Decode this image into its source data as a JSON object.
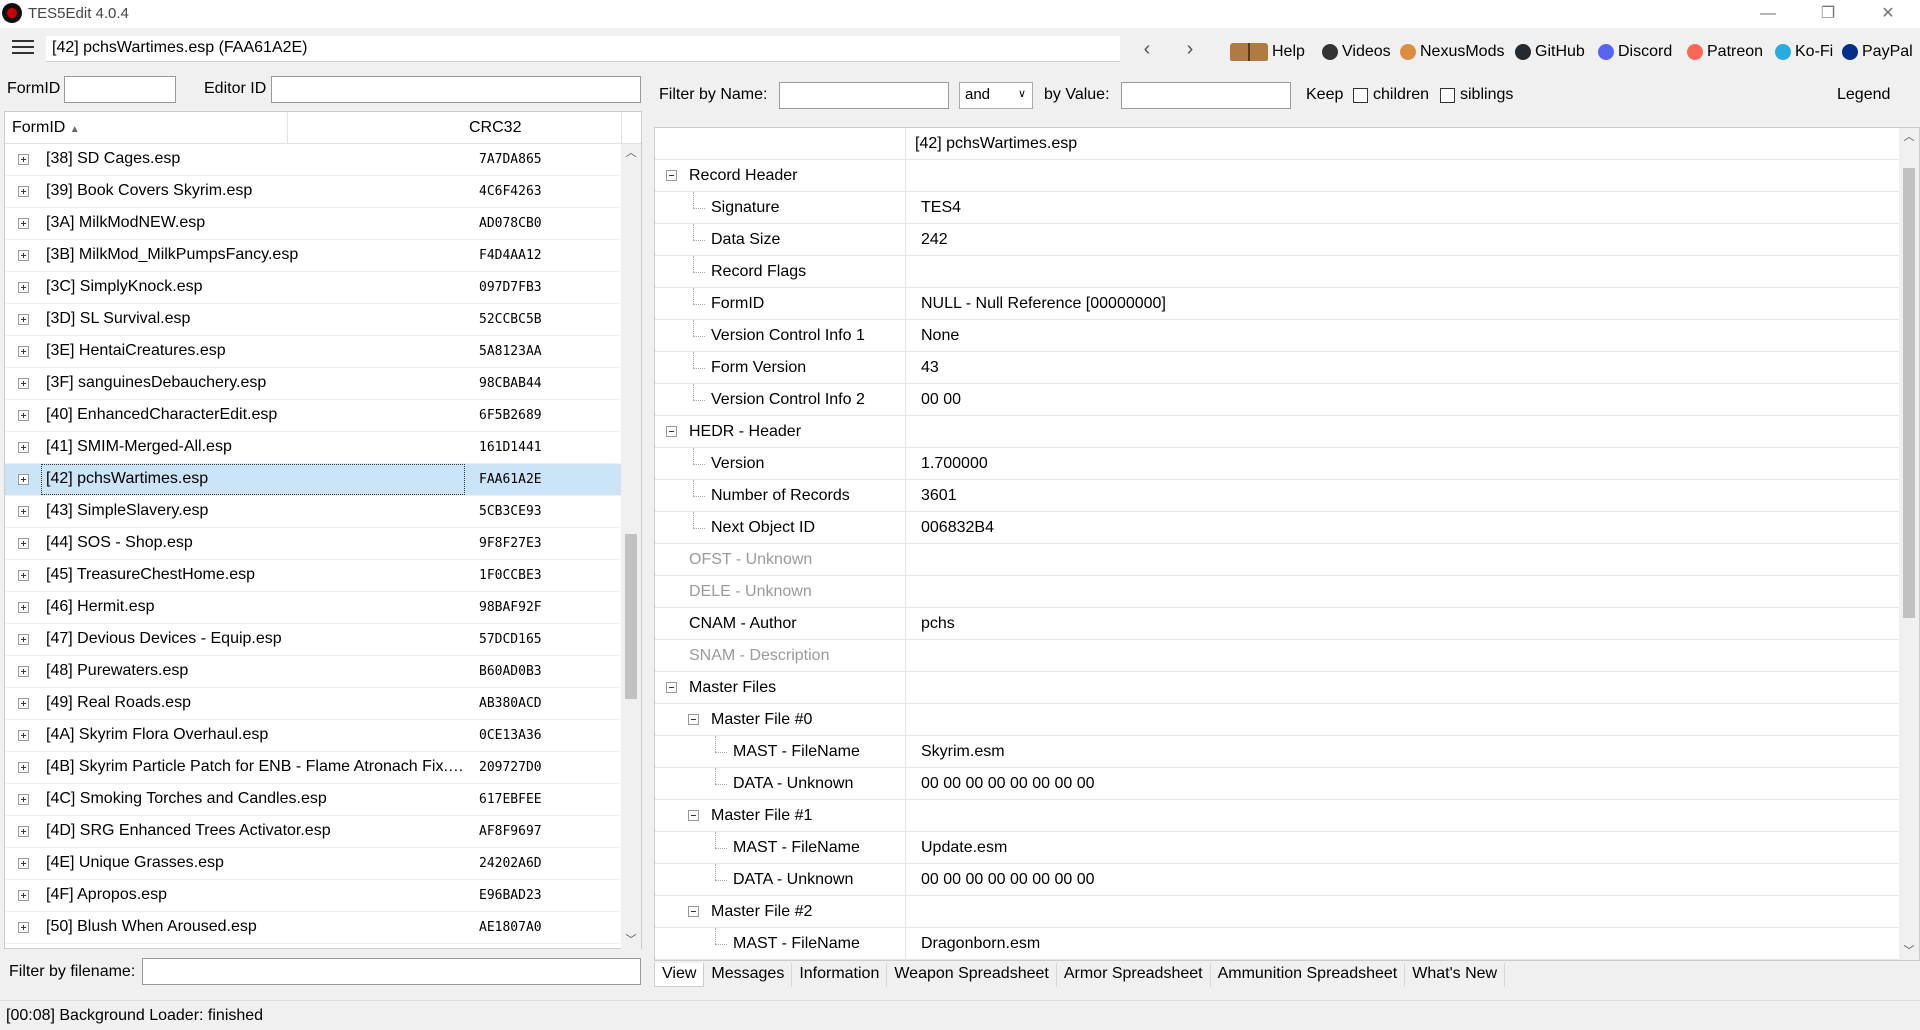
{
  "window": {
    "title": "TES5Edit 4.0.4",
    "minimize": "—",
    "restore": "❐",
    "close": "✕"
  },
  "toolbar": {
    "path": "[42] pchsWartimes.esp (FAA61A2E)",
    "back": "‹",
    "forward": "›",
    "links": [
      {
        "label": "Help",
        "icon": "book-icon",
        "color": "#8a5a2b"
      },
      {
        "label": "Videos",
        "icon": "videos-icon",
        "color": "#333333"
      },
      {
        "label": "NexusMods",
        "icon": "nexusmods-icon",
        "color": "#d98f40"
      },
      {
        "label": "GitHub",
        "icon": "github-icon",
        "color": "#24292e"
      },
      {
        "label": "Discord",
        "icon": "discord-icon",
        "color": "#5865f2"
      },
      {
        "label": "Patreon",
        "icon": "patreon-icon",
        "color": "#f96854"
      },
      {
        "label": "Ko-Fi",
        "icon": "kofi-icon",
        "color": "#29abe0"
      },
      {
        "label": "PayPal",
        "icon": "paypal-icon",
        "color": "#003087"
      }
    ]
  },
  "left": {
    "formid_label": "FormID",
    "editorid_label": "Editor ID",
    "formid_value": "",
    "editorid_value": "",
    "col_formid": "FormID",
    "col_crc": "CRC32",
    "rows": [
      {
        "name": "[38] SD Cages.esp",
        "crc": "7A7DA865"
      },
      {
        "name": "[39] Book Covers Skyrim.esp",
        "crc": "4C6F4263"
      },
      {
        "name": "[3A] MilkModNEW.esp",
        "crc": "AD078CB0"
      },
      {
        "name": "[3B] MilkMod_MilkPumpsFancy.esp",
        "crc": "F4D4AA12"
      },
      {
        "name": "[3C] SimplyKnock.esp",
        "crc": "097D7FB3"
      },
      {
        "name": "[3D] SL Survival.esp",
        "crc": "52CCBC5B"
      },
      {
        "name": "[3E] HentaiCreatures.esp",
        "crc": "5A8123AA"
      },
      {
        "name": "[3F] sanguinesDebauchery.esp",
        "crc": "98CBAB44"
      },
      {
        "name": "[40] EnhancedCharacterEdit.esp",
        "crc": "6F5B2689"
      },
      {
        "name": "[41] SMIM-Merged-All.esp",
        "crc": "161D1441"
      },
      {
        "name": "[42] pchsWartimes.esp",
        "crc": "FAA61A2E",
        "selected": true
      },
      {
        "name": "[43] SimpleSlavery.esp",
        "crc": "5CB3CE93"
      },
      {
        "name": "[44] SOS - Shop.esp",
        "crc": "9F8F27E3"
      },
      {
        "name": "[45] TreasureChestHome.esp",
        "crc": "1F0CCBE3"
      },
      {
        "name": "[46] Hermit.esp",
        "crc": "98BAF92F"
      },
      {
        "name": "[47] Devious Devices - Equip.esp",
        "crc": "57DCD165"
      },
      {
        "name": "[48] Purewaters.esp",
        "crc": "B60AD0B3"
      },
      {
        "name": "[49] Real Roads.esp",
        "crc": "AB380ACD"
      },
      {
        "name": "[4A] Skyrim Flora Overhaul.esp",
        "crc": "0CE13A36"
      },
      {
        "name": "[4B] Skyrim Particle Patch for ENB - Flame Atronach Fix.…",
        "crc": "209727D0"
      },
      {
        "name": "[4C] Smoking Torches and Candles.esp",
        "crc": "617EBFEE"
      },
      {
        "name": "[4D] SRG Enhanced Trees Activator.esp",
        "crc": "AF8F9697"
      },
      {
        "name": "[4E] Unique Grasses.esp",
        "crc": "24202A6D"
      },
      {
        "name": "[4F] Apropos.esp",
        "crc": "E96BAD23"
      },
      {
        "name": "[50] Blush When Aroused.esp",
        "crc": "AE1807A0"
      }
    ],
    "filter_label": "Filter by filename:",
    "filter_value": ""
  },
  "right": {
    "filter_name_label": "Filter by Name:",
    "filter_name_value": "",
    "operator": "and",
    "filter_value_label": "by Value:",
    "filter_value_value": "",
    "keep_label": "Keep",
    "children_label": "children",
    "siblings_label": "siblings",
    "legend_label": "Legend",
    "file_header": "[42] pchsWartimes.esp",
    "tree": [
      {
        "name": "Record Header",
        "value": "",
        "depth": 0,
        "expanded": true
      },
      {
        "name": "Signature",
        "value": "TES4",
        "depth": 1
      },
      {
        "name": "Data Size",
        "value": "242",
        "depth": 1
      },
      {
        "name": "Record Flags",
        "value": "",
        "depth": 1
      },
      {
        "name": "FormID",
        "value": "NULL - Null Reference [00000000]",
        "depth": 1
      },
      {
        "name": "Version Control Info 1",
        "value": "None",
        "depth": 1
      },
      {
        "name": "Form Version",
        "value": "43",
        "depth": 1
      },
      {
        "name": "Version Control Info 2",
        "value": "00 00",
        "depth": 1
      },
      {
        "name": "HEDR - Header",
        "value": "",
        "depth": 0,
        "expanded": true
      },
      {
        "name": "Version",
        "value": "1.700000",
        "depth": 1
      },
      {
        "name": "Number of Records",
        "value": "3601",
        "depth": 1
      },
      {
        "name": "Next Object ID",
        "value": "006832B4",
        "depth": 1
      },
      {
        "name": "OFST - Unknown",
        "value": "",
        "depth": 0,
        "gray": true
      },
      {
        "name": "DELE - Unknown",
        "value": "",
        "depth": 0,
        "gray": true
      },
      {
        "name": "CNAM - Author",
        "value": "pchs",
        "depth": 0
      },
      {
        "name": "SNAM - Description",
        "value": "",
        "depth": 0,
        "gray": true
      },
      {
        "name": "Master Files",
        "value": "",
        "depth": 0,
        "expanded": true
      },
      {
        "name": "Master File #0",
        "value": "",
        "depth": 1,
        "expanded": true
      },
      {
        "name": "MAST - FileName",
        "value": "Skyrim.esm",
        "depth": 2
      },
      {
        "name": "DATA - Unknown",
        "value": "00 00 00 00 00 00 00 00",
        "depth": 2
      },
      {
        "name": "Master File #1",
        "value": "",
        "depth": 1,
        "expanded": true
      },
      {
        "name": "MAST - FileName",
        "value": "Update.esm",
        "depth": 2
      },
      {
        "name": "DATA - Unknown",
        "value": "00 00 00 00 00 00 00 00",
        "depth": 2
      },
      {
        "name": "Master File #2",
        "value": "",
        "depth": 1,
        "expanded": true
      },
      {
        "name": "MAST - FileName",
        "value": "Dragonborn.esm",
        "depth": 2
      }
    ],
    "tabs": [
      "View",
      "Messages",
      "Information",
      "Weapon Spreadsheet",
      "Armor Spreadsheet",
      "Ammunition Spreadsheet",
      "What's New"
    ],
    "active_tab": "View"
  },
  "status": "[00:08] Background Loader: finished"
}
